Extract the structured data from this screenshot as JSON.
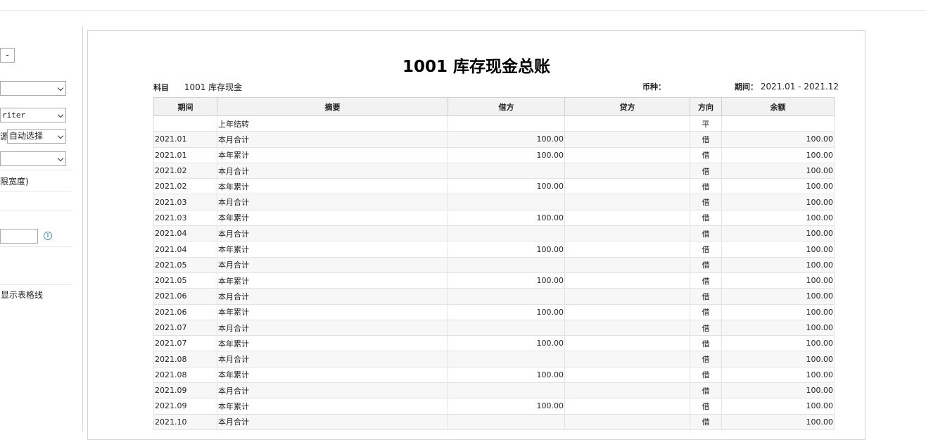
{
  "left_panel": {
    "dash_button": "-",
    "select_1": "",
    "printer_select": "riter",
    "source_label": "源",
    "source_select": "自动选择",
    "select_3": "",
    "width_option": "限宽度)",
    "number_input": "",
    "show_gridlines": "显示表格线"
  },
  "report": {
    "title": "1001 库存现金总账",
    "subject_label": "科目",
    "subject_value": "1001 库存现金",
    "currency_label": "币种：",
    "currency_value": "",
    "period_label": "期间：",
    "period_value": "2021.01 - 2021.12",
    "columns": [
      "期间",
      "摘要",
      "借方",
      "贷方",
      "方向",
      "余额"
    ],
    "rows": [
      {
        "period": "",
        "summary": "上年结转",
        "debit": "",
        "credit": "",
        "direction": "平",
        "balance": ""
      },
      {
        "period": "2021.01",
        "summary": "本月合计",
        "debit": "100.00",
        "credit": "",
        "direction": "借",
        "balance": "100.00"
      },
      {
        "period": "2021.01",
        "summary": "本年累计",
        "debit": "100.00",
        "credit": "",
        "direction": "借",
        "balance": "100.00"
      },
      {
        "period": "2021.02",
        "summary": "本月合计",
        "debit": "",
        "credit": "",
        "direction": "借",
        "balance": "100.00"
      },
      {
        "period": "2021.02",
        "summary": "本年累计",
        "debit": "100.00",
        "credit": "",
        "direction": "借",
        "balance": "100.00"
      },
      {
        "period": "2021.03",
        "summary": "本月合计",
        "debit": "",
        "credit": "",
        "direction": "借",
        "balance": "100.00"
      },
      {
        "period": "2021.03",
        "summary": "本年累计",
        "debit": "100.00",
        "credit": "",
        "direction": "借",
        "balance": "100.00"
      },
      {
        "period": "2021.04",
        "summary": "本月合计",
        "debit": "",
        "credit": "",
        "direction": "借",
        "balance": "100.00"
      },
      {
        "period": "2021.04",
        "summary": "本年累计",
        "debit": "100.00",
        "credit": "",
        "direction": "借",
        "balance": "100.00"
      },
      {
        "period": "2021.05",
        "summary": "本月合计",
        "debit": "",
        "credit": "",
        "direction": "借",
        "balance": "100.00"
      },
      {
        "period": "2021.05",
        "summary": "本年累计",
        "debit": "100.00",
        "credit": "",
        "direction": "借",
        "balance": "100.00"
      },
      {
        "period": "2021.06",
        "summary": "本月合计",
        "debit": "",
        "credit": "",
        "direction": "借",
        "balance": "100.00"
      },
      {
        "period": "2021.06",
        "summary": "本年累计",
        "debit": "100.00",
        "credit": "",
        "direction": "借",
        "balance": "100.00"
      },
      {
        "period": "2021.07",
        "summary": "本月合计",
        "debit": "",
        "credit": "",
        "direction": "借",
        "balance": "100.00"
      },
      {
        "period": "2021.07",
        "summary": "本年累计",
        "debit": "100.00",
        "credit": "",
        "direction": "借",
        "balance": "100.00"
      },
      {
        "period": "2021.08",
        "summary": "本月合计",
        "debit": "",
        "credit": "",
        "direction": "借",
        "balance": "100.00"
      },
      {
        "period": "2021.08",
        "summary": "本年累计",
        "debit": "100.00",
        "credit": "",
        "direction": "借",
        "balance": "100.00"
      },
      {
        "period": "2021.09",
        "summary": "本月合计",
        "debit": "",
        "credit": "",
        "direction": "借",
        "balance": "100.00"
      },
      {
        "period": "2021.09",
        "summary": "本年累计",
        "debit": "100.00",
        "credit": "",
        "direction": "借",
        "balance": "100.00"
      },
      {
        "period": "2021.10",
        "summary": "本月合计",
        "debit": "",
        "credit": "",
        "direction": "借",
        "balance": "100.00"
      }
    ]
  }
}
